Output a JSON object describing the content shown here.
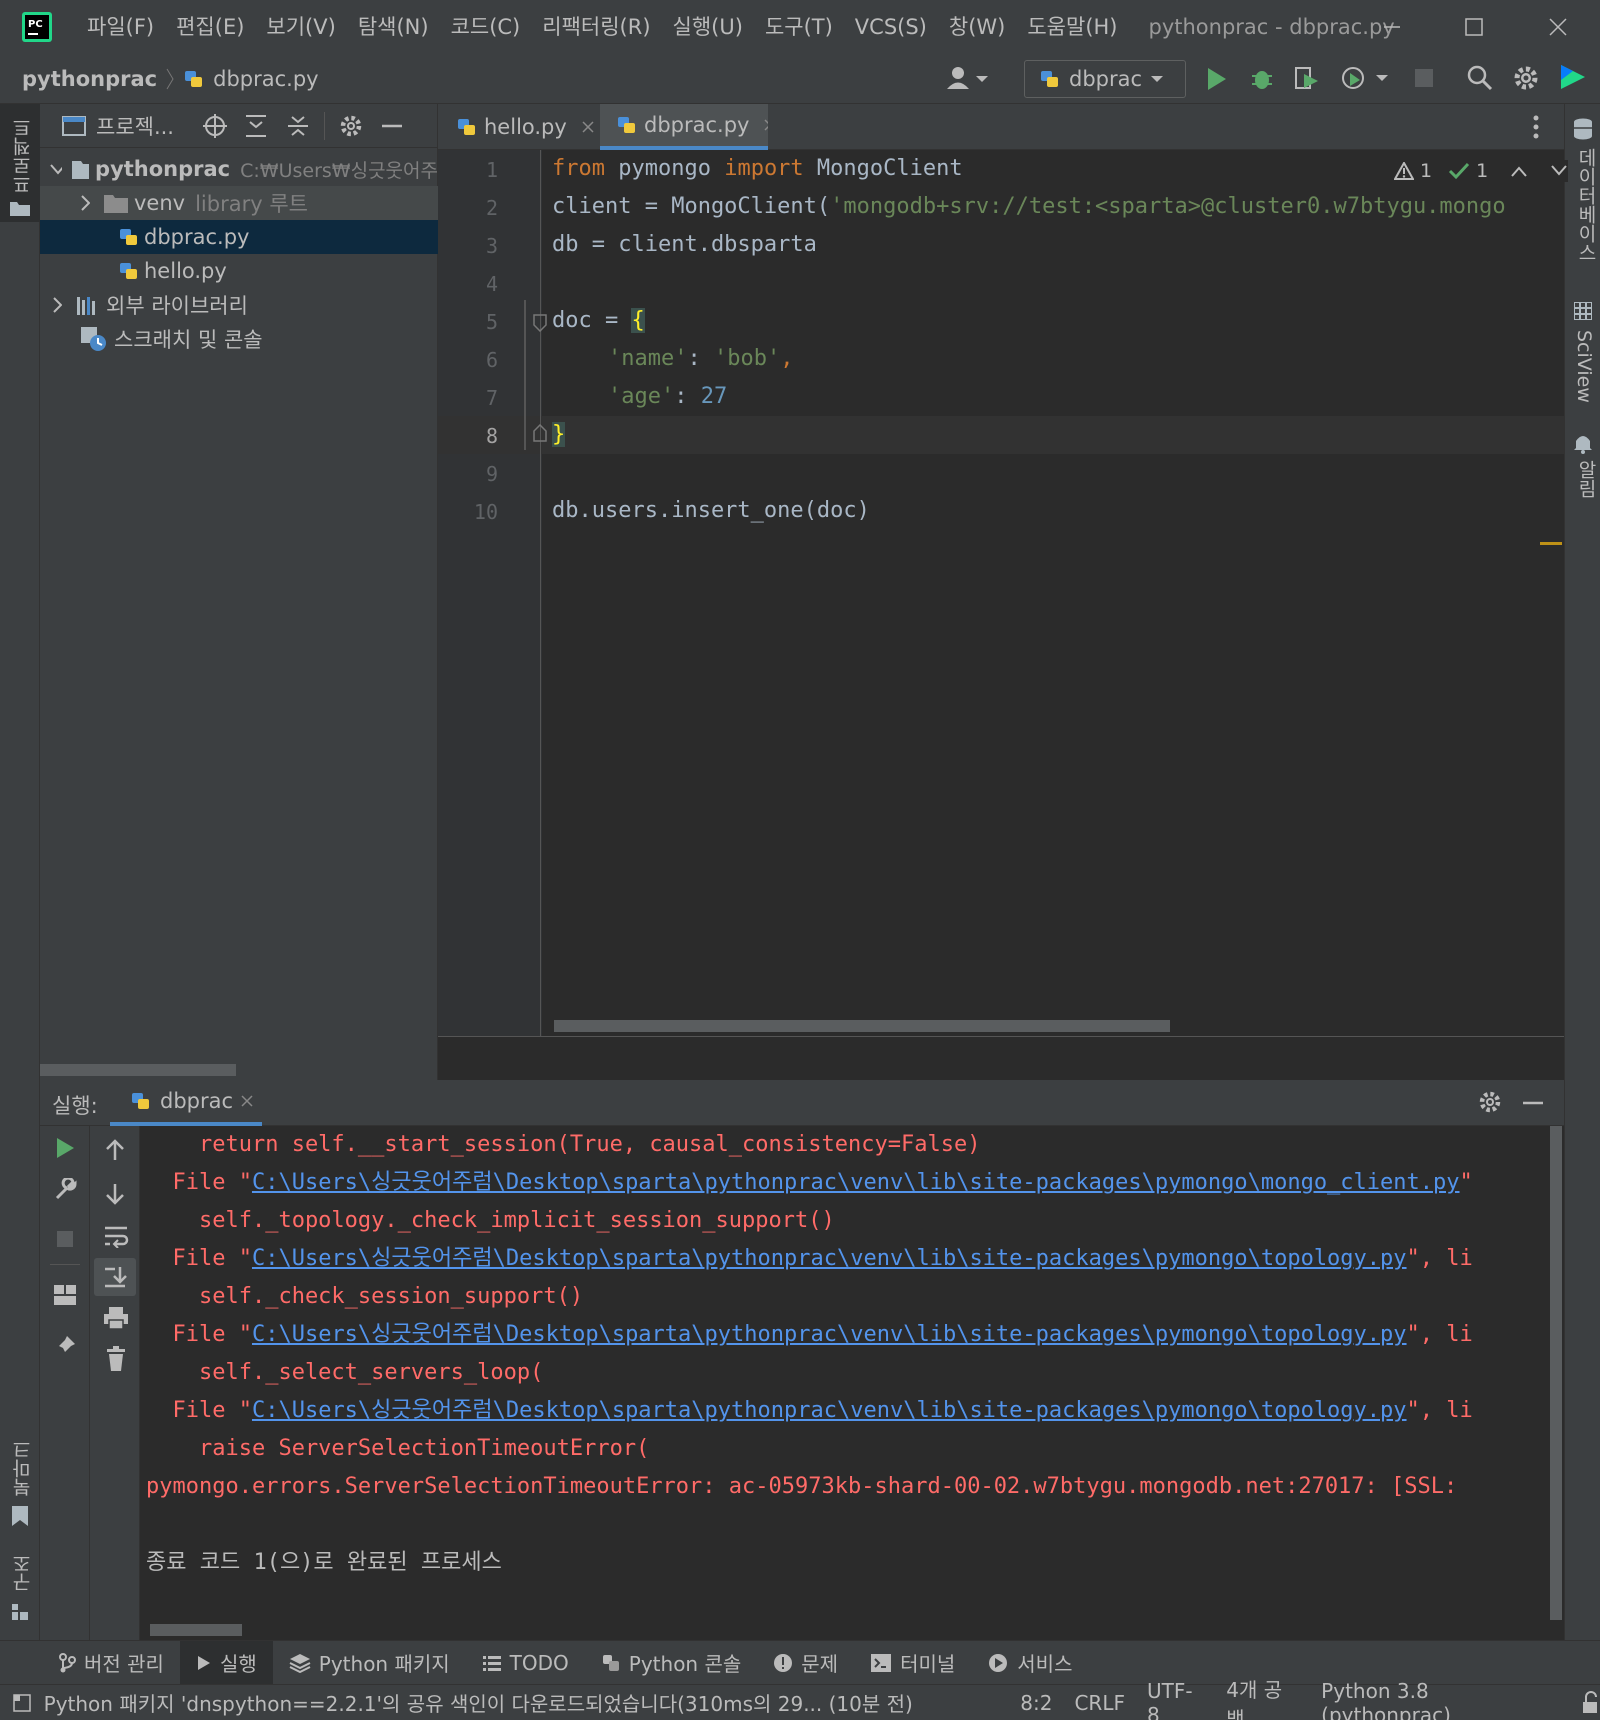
{
  "titlebar": {
    "menu": [
      "파일(F)",
      "편집(E)",
      "보기(V)",
      "탐색(N)",
      "코드(C)",
      "리팩터링(R)",
      "실행(U)",
      "도구(T)",
      "VCS(S)",
      "창(W)",
      "도움말(H)"
    ],
    "window_title": "pythonprac - dbprac.py"
  },
  "navbar": {
    "project": "pythonprac",
    "file": "dbprac.py",
    "run_config": "dbprac"
  },
  "stripes": {
    "left_top": "프로젝트",
    "left_bookmark": "북마크",
    "left_structure": "구조",
    "right_db": "데이터베이스",
    "right_sciview": "SciView",
    "right_notifications": "알림"
  },
  "project": {
    "title": "프로젝...",
    "root_name": "pythonprac",
    "root_path": "C:₩Users₩싱긋웃어주",
    "venv": "venv",
    "venv_note": "library 루트",
    "file1": "dbprac.py",
    "file2": "hello.py",
    "ext_libs": "외부 라이브러리",
    "scratches": "스크래치 및 콘솔"
  },
  "editor": {
    "tabs": [
      "hello.py",
      "dbprac.py"
    ],
    "warnings": "1",
    "ok": "1",
    "line_numbers": [
      "1",
      "2",
      "3",
      "4",
      "5",
      "6",
      "7",
      "8",
      "9",
      "10"
    ],
    "code": {
      "l1_kw1": "from",
      "l1_mid": " pymongo ",
      "l1_kw2": "import",
      "l1_end": " MongoClient",
      "l2_a": "client = MongoClient(",
      "l2_str": "'mongodb+srv://test:<sparta>@cluster0.w7btygu.mongo",
      "l3": "db = client.dbsparta",
      "l5_a": "doc = ",
      "l5_b": "{",
      "l6_k": "'name'",
      "l6_c": ": ",
      "l6_v": "'bob'",
      "l6_e": ",",
      "l7_k": "'age'",
      "l7_c": ": ",
      "l7_v": "27",
      "l8": "}",
      "l10": "db.users.insert_one(doc)"
    }
  },
  "run": {
    "label": "실행:",
    "tab": "dbprac",
    "lines": [
      {
        "pre": "    return self.__start_session(True, causal_consistency=False)"
      },
      {
        "pre": "  File \"",
        "link": "C:\\Users\\싱긋웃어주럼\\Desktop\\sparta\\pythonprac\\venv\\lib\\site-packages\\pymongo\\mongo_client.py",
        "post": "\""
      },
      {
        "pre": "    self._topology._check_implicit_session_support()"
      },
      {
        "pre": "  File \"",
        "link": "C:\\Users\\싱긋웃어주럼\\Desktop\\sparta\\pythonprac\\venv\\lib\\site-packages\\pymongo\\topology.py",
        "post": "\", li"
      },
      {
        "pre": "    self._check_session_support()"
      },
      {
        "pre": "  File \"",
        "link": "C:\\Users\\싱긋웃어주럼\\Desktop\\sparta\\pythonprac\\venv\\lib\\site-packages\\pymongo\\topology.py",
        "post": "\", li"
      },
      {
        "pre": "    self._select_servers_loop("
      },
      {
        "pre": "  File \"",
        "link": "C:\\Users\\싱긋웃어주럼\\Desktop\\sparta\\pythonprac\\venv\\lib\\site-packages\\pymongo\\topology.py",
        "post": "\", li"
      },
      {
        "pre": "    raise ServerSelectionTimeoutError("
      },
      {
        "pre": "pymongo.errors.ServerSelectionTimeoutError: ac-05973kb-shard-00-02.w7btygu.mongodb.net:27017: [SSL:"
      },
      {
        "pre": ""
      },
      {
        "pre": "종료 코드 1(으)로 완료된 프로세스",
        "gray": true
      }
    ]
  },
  "toolwindows": [
    "버전 관리",
    "실행",
    "Python 패키지",
    "TODO",
    "Python 콘솔",
    "문제",
    "터미널",
    "서비스"
  ],
  "status": {
    "message": "Python 패키지 'dnspython==2.2.1'의 공유 색인이 다운로드되었습니다(310ms의 29... (10분 전)",
    "position": "8:2",
    "line_sep": "CRLF",
    "encoding": "UTF-8",
    "indent": "4개 공백",
    "interpreter": "Python 3.8 (pythonprac)"
  },
  "colors": {
    "bg": "#2b2b2b",
    "panel": "#3c3f41",
    "keyword": "#cc7832",
    "string": "#6a8759",
    "number": "#6897bb",
    "error": "#ff6b68",
    "link": "#5394ec",
    "selection": "#0d293e",
    "run_green": "#59a869"
  }
}
